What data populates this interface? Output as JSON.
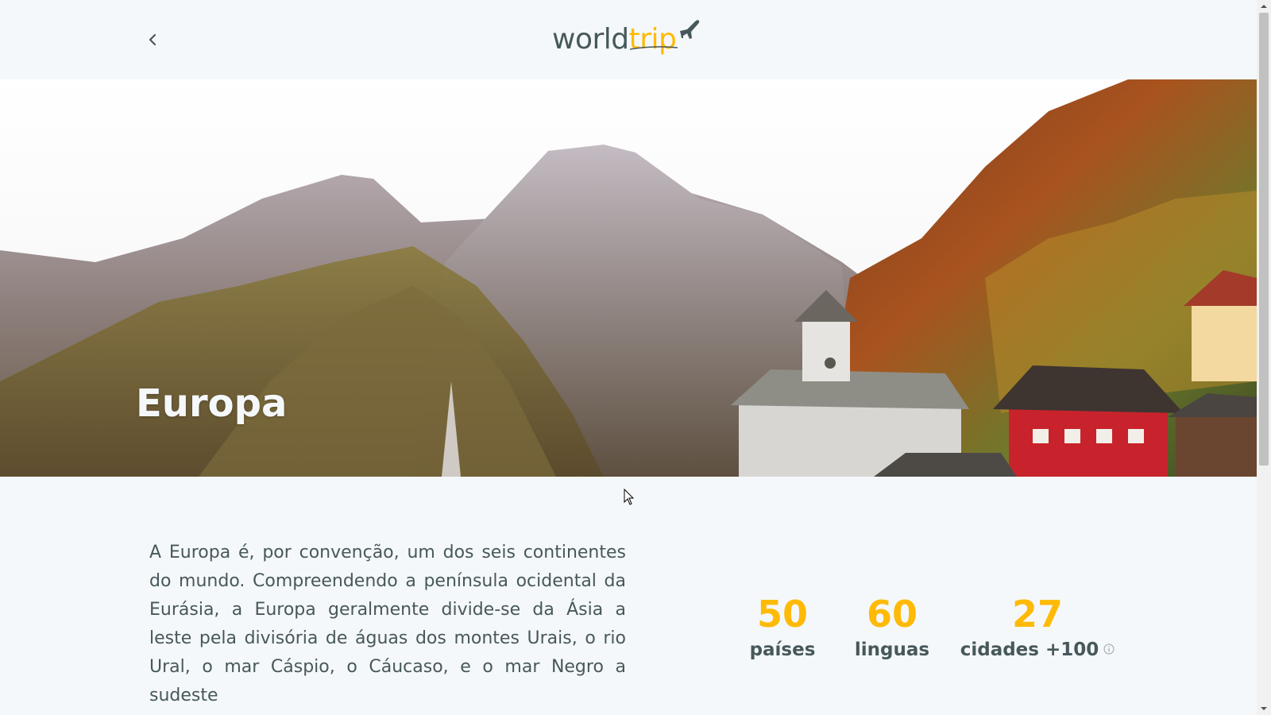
{
  "header": {
    "back_icon": "chevron-left-icon",
    "logo": {
      "part1": "world",
      "part2": "trip",
      "icon": "airplane-icon"
    }
  },
  "hero": {
    "title": "Europa",
    "image": "mountain-village-landscape"
  },
  "main": {
    "description": "A Europa é, por convenção, um dos seis continentes do mundo. Compreendendo a península ocidental da Eurásia, a Europa geralmente divide-se da Ásia a leste pela divisória de águas dos montes Urais, o rio Ural, o mar Cáspio, o Cáucaso, e o mar Negro a sudeste",
    "stats": [
      {
        "value": "50",
        "label": "países"
      },
      {
        "value": "60",
        "label": "linguas"
      },
      {
        "value": "27",
        "label": "cidades +100",
        "icon": "info-icon"
      }
    ]
  },
  "colors": {
    "accent": "#ffba08",
    "text": "#47585b",
    "background": "#f5f8fa"
  }
}
